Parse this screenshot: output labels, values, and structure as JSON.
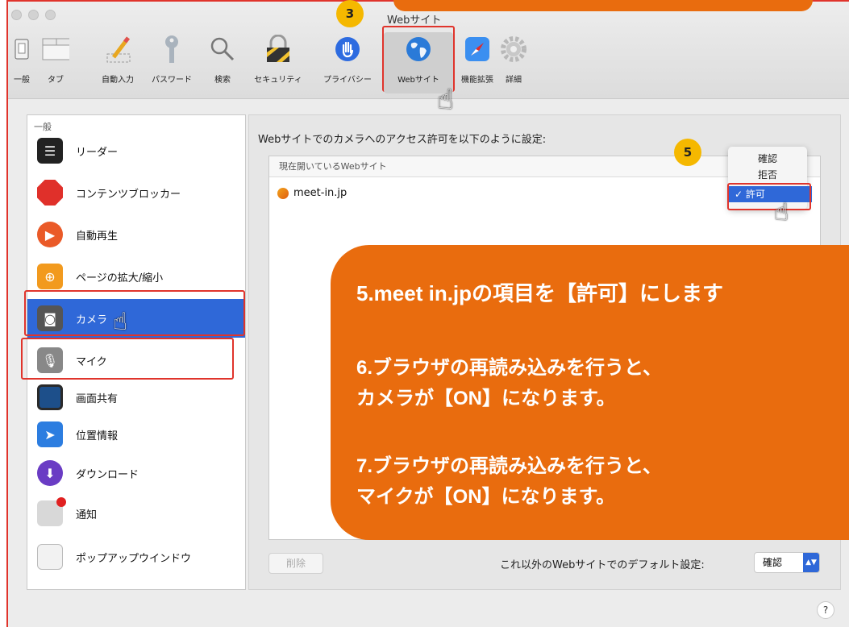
{
  "window": {
    "title": "Webサイト"
  },
  "toolbar": {
    "items": [
      {
        "label": "一般"
      },
      {
        "label": "タブ"
      },
      {
        "label": "自動入力"
      },
      {
        "label": "パスワード"
      },
      {
        "label": "検索"
      },
      {
        "label": "セキュリティ"
      },
      {
        "label": "プライバシー"
      },
      {
        "label": "Webサイト"
      },
      {
        "label": "機能拡張"
      },
      {
        "label": "詳細"
      }
    ]
  },
  "sidebar": {
    "header": "一般",
    "items": [
      {
        "label": "リーダー",
        "icon": "reader-icon"
      },
      {
        "label": "コンテンツブロッカー",
        "icon": "stop-icon"
      },
      {
        "label": "自動再生",
        "icon": "play-icon"
      },
      {
        "label": "ページの拡大/縮小",
        "icon": "zoom-icon"
      },
      {
        "label": "カメラ",
        "icon": "camera-icon"
      },
      {
        "label": "マイク",
        "icon": "microphone-icon"
      },
      {
        "label": "画面共有",
        "icon": "screen-share-icon"
      },
      {
        "label": "位置情報",
        "icon": "location-icon"
      },
      {
        "label": "ダウンロード",
        "icon": "download-icon"
      },
      {
        "label": "通知",
        "icon": "notification-icon"
      },
      {
        "label": "ポップアップウインドウ",
        "icon": "popup-icon"
      }
    ]
  },
  "main": {
    "title": "Webサイトでのカメラへのアクセス許可を以下のように設定:",
    "list_header": "現在開いているWebサイト",
    "site": "meet-in.jp",
    "menu_options": [
      "確認",
      "拒否",
      "✓ 許可"
    ],
    "delete_label": "削除",
    "default_label": "これ以外のWebサイトでのデフォルト設定:",
    "default_value": "確認",
    "help_label": "?"
  },
  "badges": {
    "step3": "3",
    "step5": "5"
  },
  "callout": {
    "line1": "5.meet in.jpの項目を【許可】にします",
    "line2": "6.ブラウザの再読み込みを行うと、",
    "line3": "カメラが【ON】になります。",
    "line4": "7.ブラウザの再読み込みを行うと、",
    "line5": "マイクが【ON】になります。"
  },
  "colors": {
    "accent": "#2f68d8",
    "callout": "#e96c0e",
    "badge": "#f5b800",
    "highlight": "#e0342c"
  }
}
